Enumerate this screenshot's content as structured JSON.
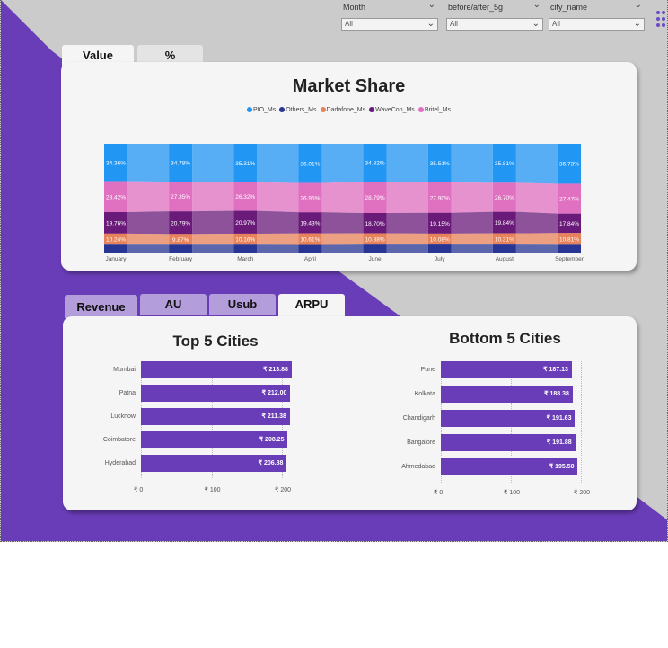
{
  "filters": [
    {
      "label": "Month",
      "value": "All"
    },
    {
      "label": "before/after_5g",
      "value": "All"
    },
    {
      "label": "city_name",
      "value": "All"
    }
  ],
  "top_tabs": [
    {
      "label": "Value",
      "active": true
    },
    {
      "label": "%",
      "active": false
    }
  ],
  "bottom_tabs": [
    {
      "label": "Revenue",
      "active": false
    },
    {
      "label": "AU",
      "active": false
    },
    {
      "label": "Usub",
      "active": false
    },
    {
      "label": "ARPU",
      "active": true
    }
  ],
  "colors": {
    "purple": "#6a3db8",
    "pio": "#2196f3",
    "others": "#283593",
    "dadafone": "#e8825a",
    "wavecon": "#6a1b7a",
    "britel": "#e070c0"
  },
  "chart_data": [
    {
      "type": "bar",
      "stacked": true,
      "title": "Market Share",
      "categories": [
        "January",
        "February",
        "March",
        "April",
        "June",
        "July",
        "August",
        "September"
      ],
      "series": [
        {
          "name": "PIO_Ms",
          "values": [
            34.36,
            34.78,
            35.31,
            36.01,
            34.82,
            35.51,
            35.81,
            36.73
          ]
        },
        {
          "name": "Britel_Ms",
          "values": [
            28.42,
            27.35,
            26.32,
            26.95,
            28.79,
            27.9,
            26.7,
            27.47
          ]
        },
        {
          "name": "WaveCon_Ms",
          "values": [
            19.76,
            20.79,
            20.97,
            19.43,
            18.7,
            19.15,
            19.84,
            17.84
          ]
        },
        {
          "name": "Dadafone_Ms",
          "values": [
            10.24,
            9.87,
            10.16,
            10.61,
            10.38,
            10.08,
            10.31,
            10.81
          ]
        },
        {
          "name": "Others_Ms",
          "values": [
            7.22,
            7.21,
            7.24,
            7.0,
            7.31,
            7.36,
            7.34,
            7.15
          ]
        }
      ],
      "data_labels": [
        {
          "PIO_Ms": "34.36%",
          "Britel_Ms": "28.42%",
          "WaveCon_Ms": "19.76%",
          "Dadafone_Ms": "10.24%"
        },
        {
          "PIO_Ms": "34.78%",
          "Britel_Ms": "27.35%",
          "WaveCon_Ms": "20.79%",
          "Dadafone_Ms": "9.87%"
        },
        {
          "PIO_Ms": "35.31%",
          "Britel_Ms": "26.32%",
          "WaveCon_Ms": "20.97%",
          "Dadafone_Ms": "10.16%"
        },
        {
          "PIO_Ms": "36.01%",
          "Britel_Ms": "26.95%",
          "WaveCon_Ms": "19.43%",
          "Dadafone_Ms": "10.61%"
        },
        {
          "PIO_Ms": "34.82%",
          "Britel_Ms": "28.79%",
          "WaveCon_Ms": "18.70%",
          "Dadafone_Ms": "10.38%"
        },
        {
          "PIO_Ms": "35.51%",
          "Britel_Ms": "27.90%",
          "WaveCon_Ms": "19.15%",
          "Dadafone_Ms": "10.08%"
        },
        {
          "PIO_Ms": "35.81%",
          "Britel_Ms": "26.70%",
          "WaveCon_Ms": "19.84%",
          "Dadafone_Ms": "10.31%"
        },
        {
          "PIO_Ms": "36.73%",
          "Britel_Ms": "27.47%",
          "WaveCon_Ms": "17.84%",
          "Dadafone_Ms": "10.81%"
        }
      ],
      "legend_order": [
        "PIO_Ms",
        "Others_Ms",
        "Dadafone_Ms",
        "WaveCon_Ms",
        "Britel_Ms"
      ],
      "legend_position": "top-center"
    },
    {
      "type": "bar",
      "orientation": "horizontal",
      "title": "Top 5 Cities",
      "categories": [
        "Mumbai",
        "Patna",
        "Lucknow",
        "Coimbatore",
        "Hyderabad"
      ],
      "values": [
        213.88,
        212.0,
        211.38,
        208.25,
        206.88
      ],
      "value_labels": [
        "₹ 213.88",
        "₹ 212.00",
        "₹ 211.38",
        "₹ 208.25",
        "₹ 206.88"
      ],
      "xticks": [
        "₹ 0",
        "₹ 100",
        "₹ 200"
      ],
      "xlim": [
        0,
        200
      ]
    },
    {
      "type": "bar",
      "orientation": "horizontal",
      "title": "Bottom 5 Cities",
      "categories": [
        "Pune",
        "Kolkata",
        "Chandigarh",
        "Bangalore",
        "Ahmedabad"
      ],
      "values": [
        187.13,
        188.38,
        191.63,
        191.88,
        195.5
      ],
      "value_labels": [
        "₹ 187.13",
        "₹ 188.38",
        "₹ 191.63",
        "₹ 191.88",
        "₹ 195.50"
      ],
      "xticks": [
        "₹ 0",
        "₹ 100",
        "₹ 200"
      ],
      "xlim": [
        0,
        200
      ]
    }
  ]
}
